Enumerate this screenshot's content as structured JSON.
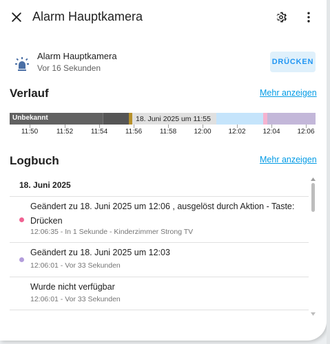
{
  "header": {
    "title": "Alarm Hauptkamera",
    "close_icon": "close-icon",
    "settings_icon": "gear-icon",
    "more_icon": "more-vert-icon"
  },
  "entity": {
    "name": "Alarm Hauptkamera",
    "state": "Vor 16 Sekunden",
    "icon": "alarm-light-icon",
    "press_label": "DRÜCKEN"
  },
  "history": {
    "title": "Verlauf",
    "more_label": "Mehr anzeigen",
    "first_state_label": "Unbekannt",
    "tooltip": "18. Juni 2025 um 11:55",
    "ticks": [
      "11:50",
      "11:52",
      "11:54",
      "11:56",
      "11:58",
      "12:00",
      "12:02",
      "12:04",
      "12:06"
    ],
    "colors": {
      "unknown": "#616161",
      "unknown_dark": "#555555",
      "marker_gold": "#b7912b",
      "light_blue": "#c5e4fb",
      "pink": "#f5b3d0",
      "lavender": "#c3b7d9"
    }
  },
  "logbook": {
    "title": "Logbuch",
    "more_label": "Mehr anzeigen",
    "date": "18. Juni 2025",
    "entries": [
      {
        "text": "Geändert zu 18. Juni 2025 um 12:06 , ausgelöst durch Aktion - Taste: Drücken",
        "sub": "12:06:35 - In 1 Sekunde - Kinderzimmer Strong TV",
        "dot_color": "#f06292"
      },
      {
        "text": "Geändert zu 18. Juni 2025 um 12:03",
        "sub": "12:06:01 - Vor 33 Sekunden",
        "dot_color": "#b39ddb"
      },
      {
        "text": "Wurde nicht verfügbar",
        "sub": "12:06:01 - Vor 33 Sekunden",
        "dot_color": ""
      }
    ]
  }
}
